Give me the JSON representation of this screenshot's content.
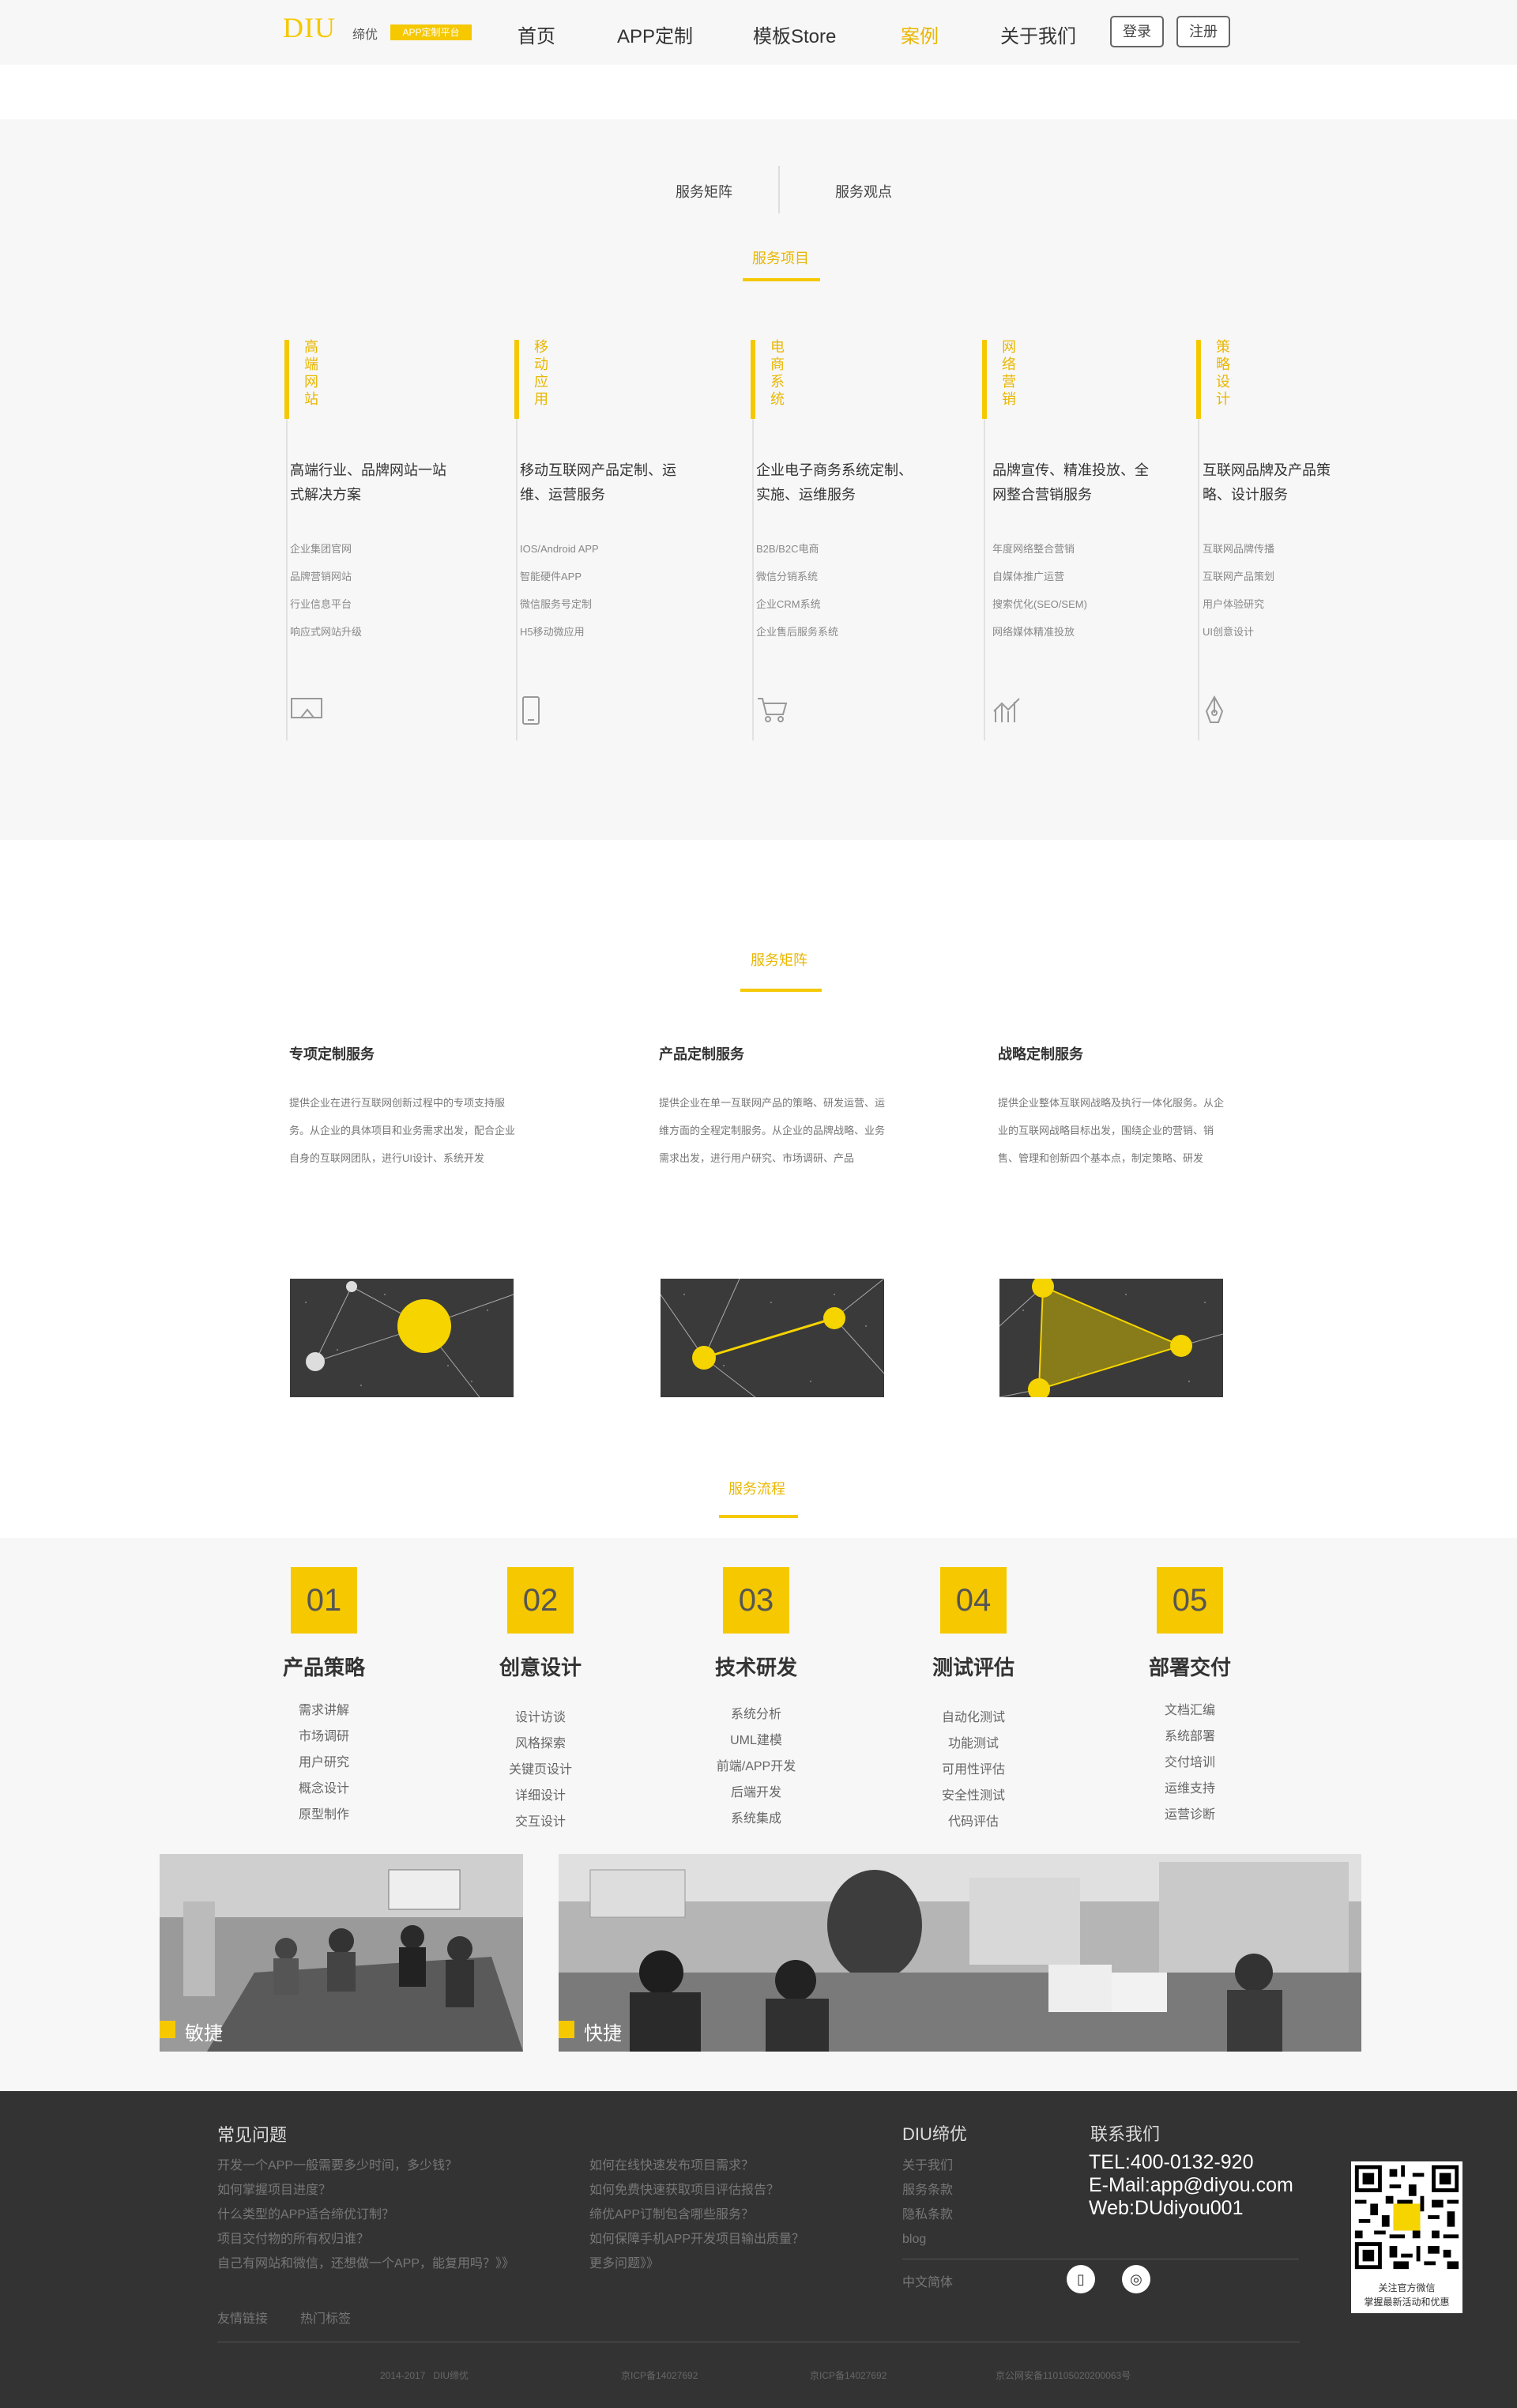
{
  "header": {
    "logo": "DIU",
    "logo_sub": "缔优",
    "logo_badge": "APP定制平台",
    "nav": [
      "首页",
      "APP定制",
      "模板Store",
      "案例",
      "关于我们"
    ],
    "active_nav": "案例",
    "login": "登录",
    "register": "注册"
  },
  "tabs": [
    "服务矩阵",
    "服务观点"
  ],
  "services": {
    "title": "服务项目",
    "columns": [
      {
        "vtitle": "高端网站",
        "title": "高端行业、品牌网站一站式解决方案",
        "items": [
          "企业集团官网",
          "品牌营销网站",
          "行业信息平台",
          "响应式网站升级"
        ],
        "icon": "monitor-icon"
      },
      {
        "vtitle": "移动应用",
        "title": "移动互联网产品定制、运维、运营服务",
        "items": [
          "IOS/Android APP",
          "智能硬件APP",
          "微信服务号定制",
          "H5移动微应用"
        ],
        "icon": "phone-icon"
      },
      {
        "vtitle": "电商系统",
        "title": "企业电子商务系统定制、实施、运维服务",
        "items": [
          "B2B/B2C电商",
          "微信分销系统",
          "企业CRM系统",
          "企业售后服务系统"
        ],
        "icon": "cart-icon"
      },
      {
        "vtitle": "网络营销",
        "title": "品牌宣传、精准投放、全网整合营销服务",
        "items": [
          "年度网络整合营销",
          "自媒体推广运营",
          "搜索优化(SEO/SEM)",
          "网络媒体精准投放"
        ],
        "icon": "chart-icon"
      },
      {
        "vtitle": "策略设计",
        "title": "互联网品牌及产品策略、设计服务",
        "items": [
          "互联网品牌传播",
          "互联网产品策划",
          "用户体验研究",
          "UI创意设计"
        ],
        "icon": "pen-icon"
      }
    ]
  },
  "matrix": {
    "title": "服务矩阵",
    "items": [
      {
        "title": "专项定制服务",
        "desc": "提供企业在进行互联网创新过程中的专项支持服务。从企业的具体项目和业务需求出发，配合企业自身的互联网团队，进行UI设计、系统开发"
      },
      {
        "title": "产品定制服务",
        "desc": "提供企业在单一互联网产品的策略、研发运营、运维方面的全程定制服务。从企业的品牌战略、业务需求出发，进行用户研究、市场调研、产品"
      },
      {
        "title": "战略定制服务",
        "desc": "提供企业整体互联网战略及执行一体化服务。从企业的互联网战略目标出发，围绕企业的营销、销售、管理和创新四个基本点，制定策略、研发"
      }
    ]
  },
  "process": {
    "title": "服务流程",
    "steps": [
      {
        "num": "01",
        "title": "产品策略",
        "items": [
          "需求讲解",
          "市场调研",
          "用户研究",
          "概念设计",
          "原型制作"
        ]
      },
      {
        "num": "02",
        "title": "创意设计",
        "items": [
          "设计访谈",
          "风格探索",
          "关键页设计",
          "详细设计",
          "交互设计"
        ]
      },
      {
        "num": "03",
        "title": "技术研发",
        "items": [
          "系统分析",
          "UML建模",
          "前端/APP开发",
          "后端开发",
          "系统集成"
        ]
      },
      {
        "num": "04",
        "title": "测试评估",
        "items": [
          "自动化测试",
          "功能测试",
          "可用性评估",
          "安全性测试",
          "代码评估"
        ]
      },
      {
        "num": "05",
        "title": "部署交付",
        "items": [
          "文档汇编",
          "系统部署",
          "交付培训",
          "运维支持",
          "运营诊断"
        ]
      }
    ],
    "photo1_label": "敏捷",
    "photo2_label": "快捷"
  },
  "footer": {
    "faq_title": "常见问题",
    "faq_left": [
      "开发一个APP一般需要多少时间，多少钱？",
      "如何掌握项目进度？",
      "什么类型的APP适合缔优订制？",
      "项目交付物的所有权归谁？",
      "自己有网站和微信，还想做一个APP，能复用吗？》》"
    ],
    "faq_right": [
      "如何在线快速发布项目需求？",
      "如何免费快速获取项目评估报告？",
      "缔优APP订制包含哪些服务？",
      "如何保障手机APP开发项目输出质量？",
      "更多问题》》"
    ],
    "diu_title": "DIU缔优",
    "diu_links": [
      "关于我们",
      "服务条款",
      "隐私条款",
      "blog"
    ],
    "lang": "中文简体",
    "contact_title": "联系我们",
    "tel": "TEL:400-0132-920",
    "email": "E-Mail:app@diyou.com",
    "web": "Web:DUdiyou001",
    "qr_text1": "关注官方微信",
    "qr_text2": "掌握最新活动和优惠",
    "links1": "友情链接",
    "links2": "热门标签",
    "copy": "2014-2017   DIU缔优",
    "icp1": "京ICP备14027692",
    "icp2": "京ICP备14027692",
    "police": "京公网安备110105020200063号"
  }
}
